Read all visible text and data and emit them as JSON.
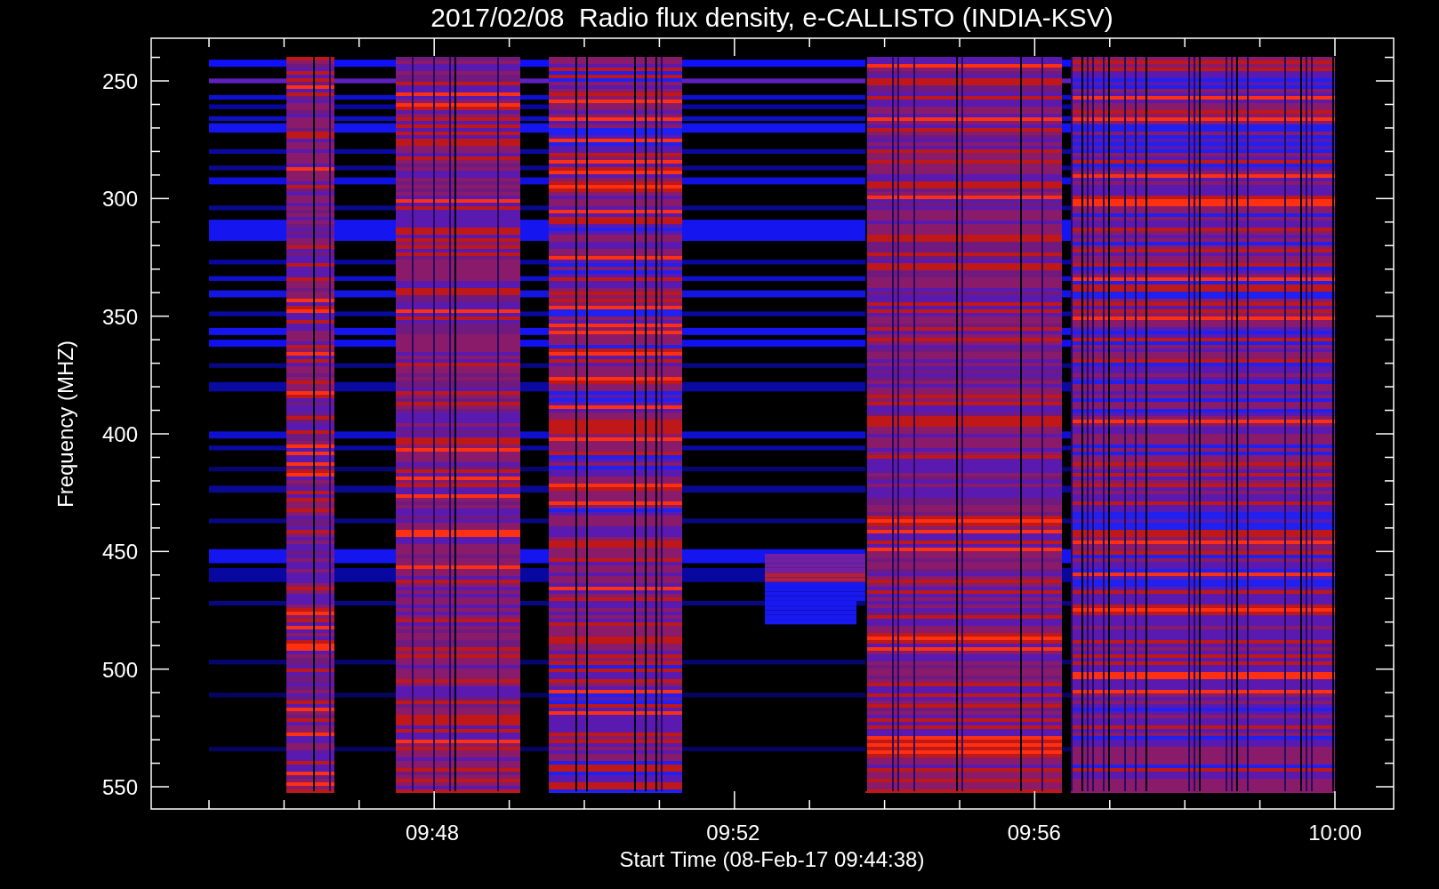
{
  "title": "2017/02/08  Radio flux density, e-CALLISTO (INDIA-KSV)",
  "y_axis": {
    "label": "Frequency (MHZ)",
    "ticks": [
      "250",
      "300",
      "350",
      "400",
      "450",
      "500",
      "550"
    ]
  },
  "x_axis": {
    "label": "Start Time (08-Feb-17 09:44:38)",
    "ticks": [
      "09:48",
      "09:52",
      "09:56",
      "10:00"
    ]
  }
}
